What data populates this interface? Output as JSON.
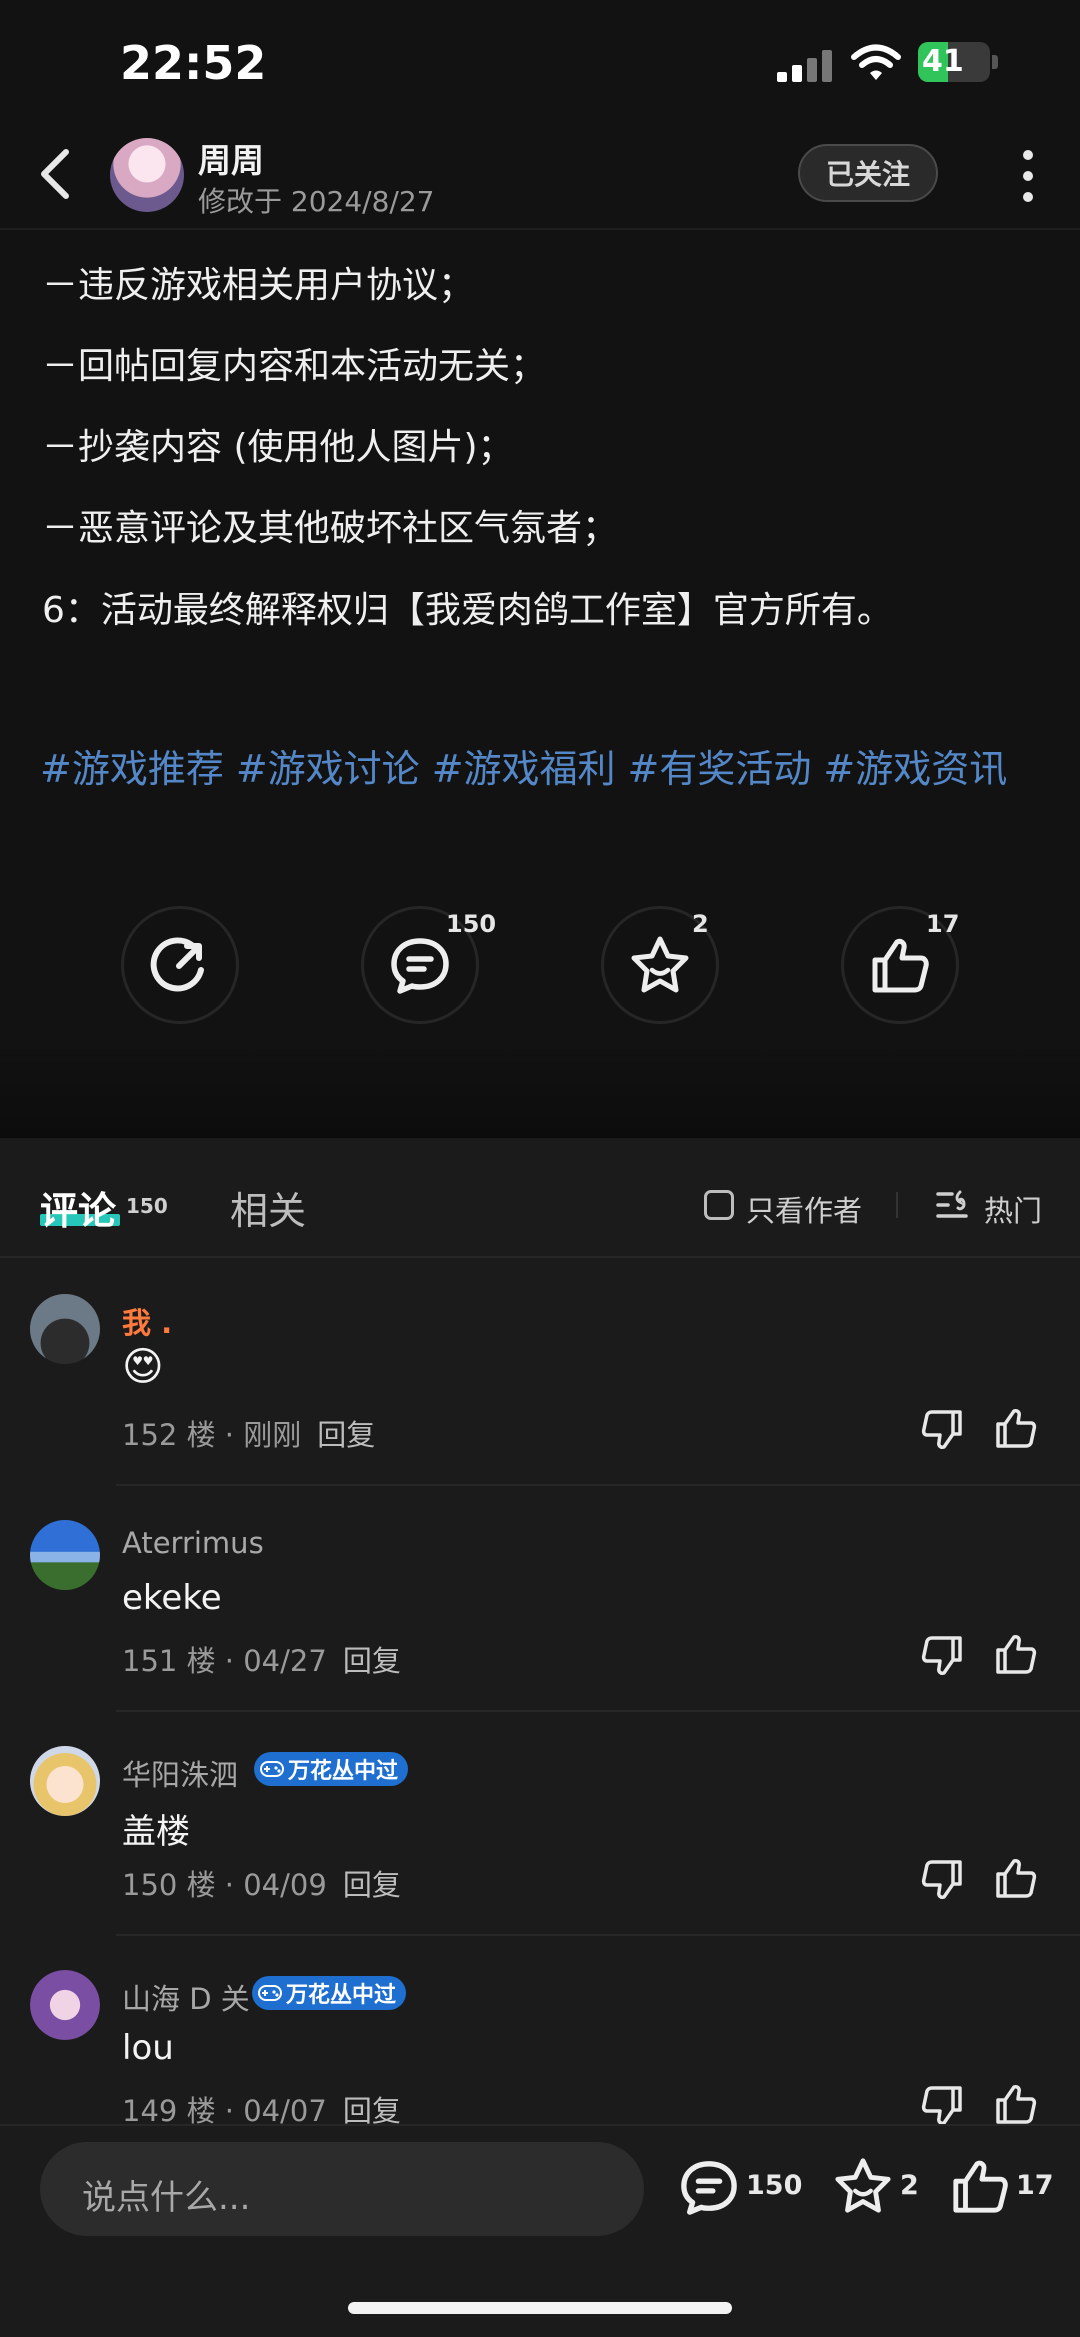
{
  "status": {
    "time": "22:52",
    "battery": "41",
    "battery_level": 0.41
  },
  "header": {
    "author": "周周",
    "modified": "修改于 2024/8/27",
    "follow_label": "已关注"
  },
  "post": {
    "rules": [
      "－违反游戏相关用户协议；",
      "－回帖回复内容和本活动无关；",
      "－抄袭内容 (使用他人图片)；",
      "－恶意评论及其他破坏社区气氛者；",
      "6：活动最终解释权归【我爱肉鸽工作室】官方所有。"
    ],
    "tags": [
      "#游戏推荐",
      "#游戏讨论",
      "#游戏福利",
      "#有奖活动",
      "#游戏资讯"
    ]
  },
  "actions": {
    "share_count": "",
    "comment_count": "150",
    "favorite_count": "2",
    "like_count": "17"
  },
  "tabs": {
    "comments_label": "评论",
    "comments_count": "150",
    "related_label": "相关",
    "only_author_label": "只看作者",
    "sort_label": "热门"
  },
  "comments": [
    {
      "name": "我 .",
      "text": "😍",
      "floor": "152 楼 · 刚刚",
      "reply": "回复",
      "badge": ""
    },
    {
      "name": "Aterrimus",
      "text": "ekeke",
      "floor": "151 楼 · 04/27",
      "reply": "回复",
      "badge": ""
    },
    {
      "name": "华阳洙泗",
      "text": "盖楼",
      "floor": "150 楼 · 04/09",
      "reply": "回复",
      "badge": "万花丛中过"
    },
    {
      "name": "山海 D 关",
      "text": "lou",
      "floor": "149 楼 · 04/07",
      "reply": "回复",
      "badge": "万花丛中过"
    }
  ],
  "bottom": {
    "placeholder": "说点什么...",
    "comment_count": "150",
    "favorite_count": "2",
    "like_count": "17"
  }
}
